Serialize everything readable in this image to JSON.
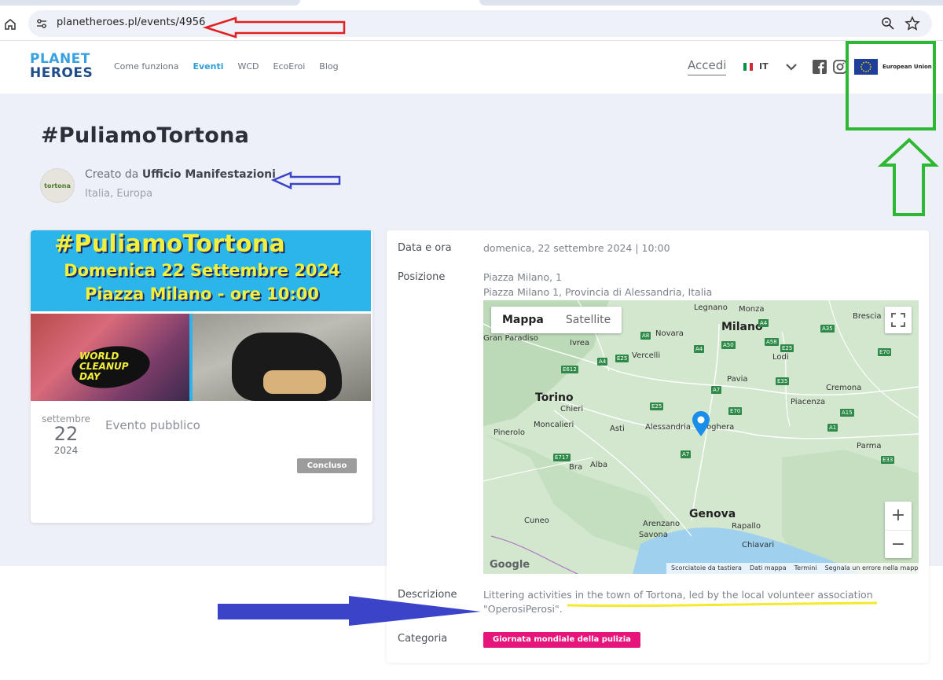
{
  "browser": {
    "url": "planetheroes.pl/events/4956"
  },
  "header": {
    "logo": {
      "line1": "PLANET",
      "line2": "HEROES"
    },
    "nav": [
      {
        "label": "Come funziona",
        "active": false
      },
      {
        "label": "Eventi",
        "active": true
      },
      {
        "label": "WCD",
        "active": false
      },
      {
        "label": "EcoEroi",
        "active": false
      },
      {
        "label": "Blog",
        "active": false
      }
    ],
    "login_label": "Accedi",
    "language": "IT",
    "eu_label": "European Union"
  },
  "event": {
    "title": "#PuliamoTortona",
    "created_by_prefix": "Creato da",
    "creator": "Ufficio Manifestazioni",
    "creator_location": "Italia, Europa",
    "avatar_text": "tortona"
  },
  "card": {
    "banner_title": "#PuliamoTortona",
    "banner_date": "Domenica 22 Settembre 2024",
    "banner_place": "Piazza Milano - ore 10:00",
    "wcd_line1": "WORLD",
    "wcd_line2": "CLEANUP",
    "wcd_line3": "DAY",
    "month": "settembre",
    "day": "22",
    "year": "2024",
    "visibility": "Evento pubblico",
    "status": "Concluso"
  },
  "details": {
    "datetime_label": "Data e ora",
    "datetime_value": "domenica, 22 settembre 2024 | 10:00",
    "position_label": "Posizione",
    "position_line1": "Piazza Milano, 1",
    "position_line2": "Piazza Milano 1, Provincia di Alessandria, Italia",
    "description_label": "Descrizione",
    "description_value": "Littering activities in the town of Tortona, led by the local volunteer association \"OperosiPerosi\".",
    "category_label": "Categoria",
    "category_value": "Giornata mondiale della pulizia"
  },
  "map": {
    "type_map": "Mappa",
    "type_satellite": "Satellite",
    "zoom_in": "+",
    "zoom_out": "−",
    "google": "Google",
    "footer": [
      "Scorciatoie da tastiera",
      "Dati mappa",
      "Termini",
      "Segnala un errore nella mappa"
    ],
    "cities": {
      "milano": "Milano",
      "torino": "Torino",
      "genova": "Genova",
      "legnano": "Legnano",
      "monza": "Monza",
      "brescia": "Brescia",
      "novara": "Novara",
      "vercelli": "Vercelli",
      "ivrea": "Ivrea",
      "gran_paradiso": "Gran Paradiso",
      "lodi": "Lodi",
      "pavia": "Pavia",
      "cremona": "Cremona",
      "piacenza": "Piacenza",
      "chieri": "Chieri",
      "moncalieri": "Moncalieri",
      "pinerolo": "Pinerolo",
      "asti": "Asti",
      "alessandria": "Alessandria",
      "voghera": "Voghera",
      "parma": "Parma",
      "bra": "Bra",
      "alba": "Alba",
      "cuneo": "Cuneo",
      "arenzano": "Arenzano",
      "savona": "Savona",
      "rapallo": "Rapallo",
      "chiavari": "Chiavari"
    },
    "highways": [
      "A4",
      "A8",
      "A50",
      "A58",
      "A35",
      "A4",
      "E25",
      "E612",
      "A4",
      "E25",
      "E70",
      "A7",
      "E35",
      "E70",
      "A1",
      "E25",
      "A7",
      "E717",
      "E33",
      "A15"
    ]
  },
  "colors": {
    "accent": "#2f9fd6",
    "category": "#e5157c",
    "status": "#9c9c9c",
    "page_bg": "#eef0f7"
  },
  "icons": [
    "home-icon",
    "tune-icon",
    "zoom-icon",
    "star-icon",
    "chevron-down-icon",
    "facebook-icon",
    "instagram-icon",
    "fullscreen-icon",
    "map-pin-icon"
  ]
}
